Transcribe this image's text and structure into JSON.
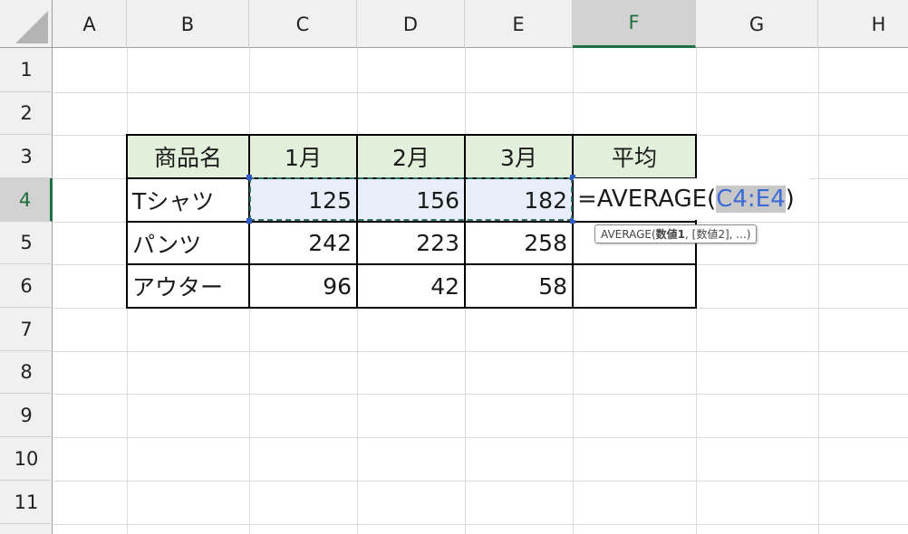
{
  "columns": [
    "A",
    "B",
    "C",
    "D",
    "E",
    "F",
    "G",
    "H"
  ],
  "rows": [
    "1",
    "2",
    "3",
    "4",
    "5",
    "6",
    "7",
    "8",
    "9",
    "10",
    "11"
  ],
  "active_column": "F",
  "active_row": "4",
  "table": {
    "headers": [
      "商品名",
      "1月",
      "2月",
      "3月",
      "平均"
    ],
    "rows": [
      {
        "name": "Tシャツ",
        "jan": "125",
        "feb": "156",
        "mar": "182"
      },
      {
        "name": "パンツ",
        "jan": "242",
        "feb": "223",
        "mar": "258"
      },
      {
        "name": "アウター",
        "jan": "96",
        "feb": "42",
        "mar": "58"
      }
    ]
  },
  "formula": {
    "prefix": "=AVERAGE(",
    "ref": "C4:E4",
    "suffix": ")"
  },
  "tooltip": {
    "func": "AVERAGE(",
    "arg1": "数値1",
    "rest": ", [数値2], ...)"
  },
  "colors": {
    "header_fill": "#e2efda",
    "selection_fill": "#e8eef7",
    "marquee": "#2e7068",
    "active_header": "#1f7145",
    "ref_text": "#3c6bd6"
  }
}
